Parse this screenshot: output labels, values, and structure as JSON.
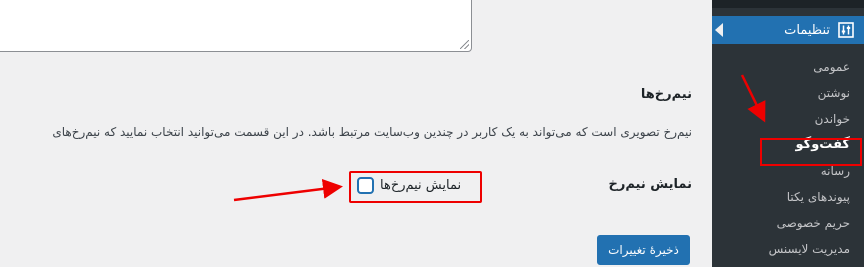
{
  "sidebar": {
    "settings_label": "تنظیمات",
    "items": [
      {
        "label": "عمومی"
      },
      {
        "label": "نوشتن"
      },
      {
        "label": "خواندن"
      },
      {
        "label": "گفت‌وگو"
      },
      {
        "label": "رسانه"
      },
      {
        "label": "پیوندهای یکتا"
      },
      {
        "label": "حریم خصوصی"
      },
      {
        "label": "مدیریت لایسنس"
      }
    ]
  },
  "main": {
    "section_title": "نیم‌رخ‌ها",
    "section_desc": "نیم‌رخ تصویری است که می‌تواند به یک کاربر در چندین وب‌سایت مرتبط باشد. در این قسمت می‌توانید انتخاب نمایید که نیم‌رخ‌های",
    "field_label": "نمایش نیم‌رخ",
    "checkbox_label": "نمایش نیم‌رخ‌ها",
    "checkbox_checked": false,
    "save_button": "ذخیرهٔ تغییرات"
  },
  "colors": {
    "accent": "#2271b1",
    "sidebar_bg": "#2c3338",
    "annotation_red": "#ee0000"
  }
}
